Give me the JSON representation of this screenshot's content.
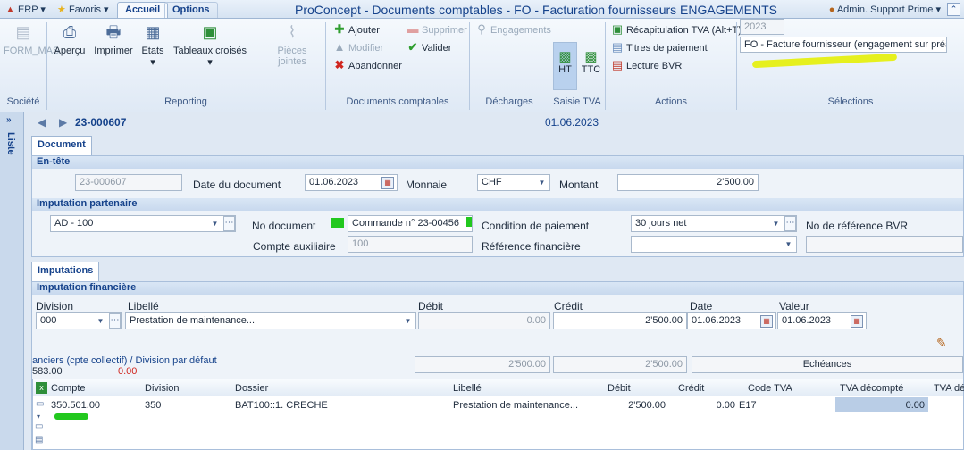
{
  "titlebar": {
    "erp_label": "ERP",
    "favorites_label": "Favoris",
    "tabs": [
      "Accueil",
      "Options"
    ],
    "window_title": "ProConcept - Documents comptables - FO - Facturation fournisseurs ENGAGEMENTS",
    "user_label": "Admin. Support Prime"
  },
  "ribbon": {
    "societe": {
      "button": "FORM_MAS",
      "group": "Société"
    },
    "reporting": {
      "buttons": [
        "Aperçu",
        "Imprimer",
        "Etats",
        "Tableaux croisés",
        "Pièces jointes"
      ],
      "group": "Reporting"
    },
    "documents": {
      "ajouter": "Ajouter",
      "modifier": "Modifier",
      "abandonner": "Abandonner",
      "supprimer": "Supprimer",
      "valider": "Valider",
      "group": "Documents comptables"
    },
    "decharges": {
      "engagements": "Engagements",
      "group": "Décharges"
    },
    "saisie_tva": {
      "ht": "HT",
      "ttc": "TTC",
      "group": "Saisie TVA"
    },
    "actions": {
      "items": [
        "Récapitulation TVA (Alt+T)",
        "Titres de paiement",
        "Lecture BVR"
      ],
      "group": "Actions"
    },
    "selections": {
      "year": "2023",
      "journal": "FO - Facture fournisseur (engagement sur préav",
      "group": "Sélections"
    }
  },
  "rail": {
    "label": "Liste"
  },
  "nav": {
    "doc_number": "23-000607",
    "date": "01.06.2023"
  },
  "document_tab": "Document",
  "entete": {
    "title": "En-tête",
    "number": "23-000607",
    "date_label": "Date du document",
    "date_value": "01.06.2023",
    "currency_label": "Monnaie",
    "currency_value": "CHF",
    "amount_label": "Montant",
    "amount_value": "2'500.00"
  },
  "partner": {
    "title": "Imputation partenaire",
    "account": "AD - 100",
    "doc_no_label": "No document",
    "doc_no_value": "Commande n° 23-00456",
    "payment_label": "Condition de paiement",
    "payment_value": "30 jours net",
    "bvr_label": "No de référence BVR",
    "aux_label": "Compte auxiliaire",
    "aux_value": "100",
    "fin_ref_label": "Référence financière"
  },
  "imputations_tab": "Imputations",
  "financial": {
    "title": "Imputation financière",
    "headers": {
      "division": "Division",
      "libelle": "Libellé",
      "debit": "Débit",
      "credit": "Crédit",
      "date": "Date",
      "valeur": "Valeur"
    },
    "division": "000",
    "libelle": "Prestation de maintenance...",
    "debit": "0.00",
    "credit": "2'500.00",
    "date": "01.06.2023",
    "valeur": "01.06.2023",
    "summary_label": "anciers (cpte collectif) / Division par défaut",
    "summary_value_1": "583.00",
    "summary_value_2": "0.00",
    "total_1": "2'500.00",
    "total_2": "2'500.00",
    "echeances": "Echéances"
  },
  "grid": {
    "headers": [
      "Compte",
      "Division",
      "Dossier",
      "Libellé",
      "Débit",
      "Crédit",
      "Code TVA",
      "TVA décompté",
      "TVA dé"
    ],
    "rows": [
      {
        "compte": "350.501.00",
        "division": "350",
        "dossier": "BAT100::1. CRECHE",
        "libelle": "Prestation de maintenance...",
        "debit": "2'500.00",
        "credit": "0.00",
        "code_tva": "E17",
        "tva_decompte": "0.00",
        "tva_de": ""
      }
    ]
  },
  "colors": {
    "accent": "#15428b",
    "highlight": "#e6f01e",
    "green_mark": "#22c81e",
    "selected_cell": "#b9cde6"
  }
}
